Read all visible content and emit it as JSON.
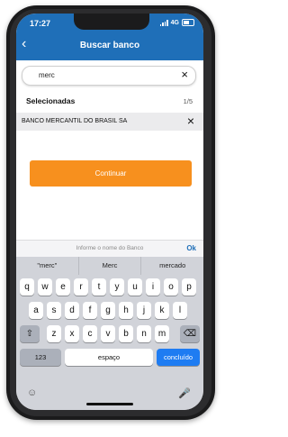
{
  "status": {
    "time": "17:27",
    "network": "4G"
  },
  "header": {
    "title": "Buscar banco"
  },
  "search": {
    "value": "merc"
  },
  "selected": {
    "label": "Selecionadas",
    "count": "1/5",
    "items": [
      "BANCO MERCANTIL DO BRASIL SA"
    ]
  },
  "actions": {
    "continue_label": "Continuar"
  },
  "accessory": {
    "hint": "Informe o nome do Banco",
    "ok_label": "Ok"
  },
  "keyboard": {
    "suggestions": [
      "\"merc\"",
      "Merc",
      "mercado"
    ],
    "row1": [
      "q",
      "w",
      "e",
      "r",
      "t",
      "y",
      "u",
      "i",
      "o",
      "p"
    ],
    "row2": [
      "a",
      "s",
      "d",
      "f",
      "g",
      "h",
      "j",
      "k",
      "l"
    ],
    "row3": [
      "z",
      "x",
      "c",
      "v",
      "b",
      "n",
      "m"
    ],
    "numbers_label": "123",
    "space_label": "espaço",
    "done_label": "concluído"
  },
  "icons": {
    "back": "back-chevron-icon",
    "clear": "close-icon",
    "shift": "shift-icon",
    "delete": "backspace-icon",
    "emoji": "emoji-icon",
    "mic": "microphone-icon"
  },
  "colors": {
    "header": "#1f6fb8",
    "button": "#f7901e",
    "done_key": "#1e7cf2"
  }
}
